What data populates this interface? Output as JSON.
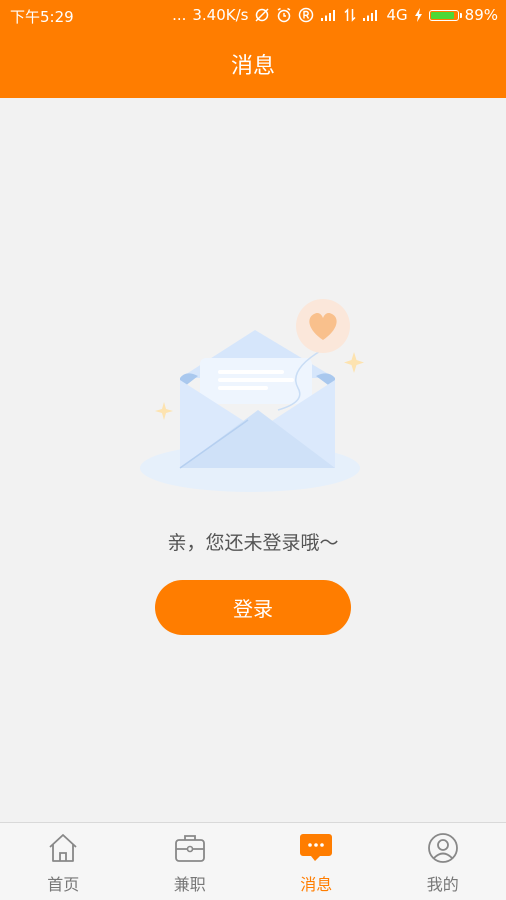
{
  "status_bar": {
    "time": "下午5:29",
    "dots": "...",
    "network_speed": "3.40K/s",
    "network_type": "4G",
    "battery_percent": "89%",
    "battery_level": 0.89,
    "icons": [
      "no-sync-icon",
      "alarm-icon",
      "r-badge-icon",
      "signal-icon",
      "data-arrows-icon",
      "signal-icon",
      "charging-icon",
      "battery-icon"
    ]
  },
  "header": {
    "title": "消息"
  },
  "empty_state": {
    "message": "亲，您还未登录哦～",
    "illustration": "envelope-heart-illustration"
  },
  "login_button": {
    "label": "登录"
  },
  "bottom_nav": {
    "items": [
      {
        "label": "首页",
        "icon": "home-icon",
        "active": false
      },
      {
        "label": "兼职",
        "icon": "briefcase-icon",
        "active": false
      },
      {
        "label": "消息",
        "icon": "message-bubble-icon",
        "active": true
      },
      {
        "label": "我的",
        "icon": "profile-icon",
        "active": false
      }
    ]
  },
  "colors": {
    "brand": "#ff7d00",
    "background": "#f2f2f2",
    "nav_inactive": "#777777",
    "battery_fill": "#4cd836"
  }
}
